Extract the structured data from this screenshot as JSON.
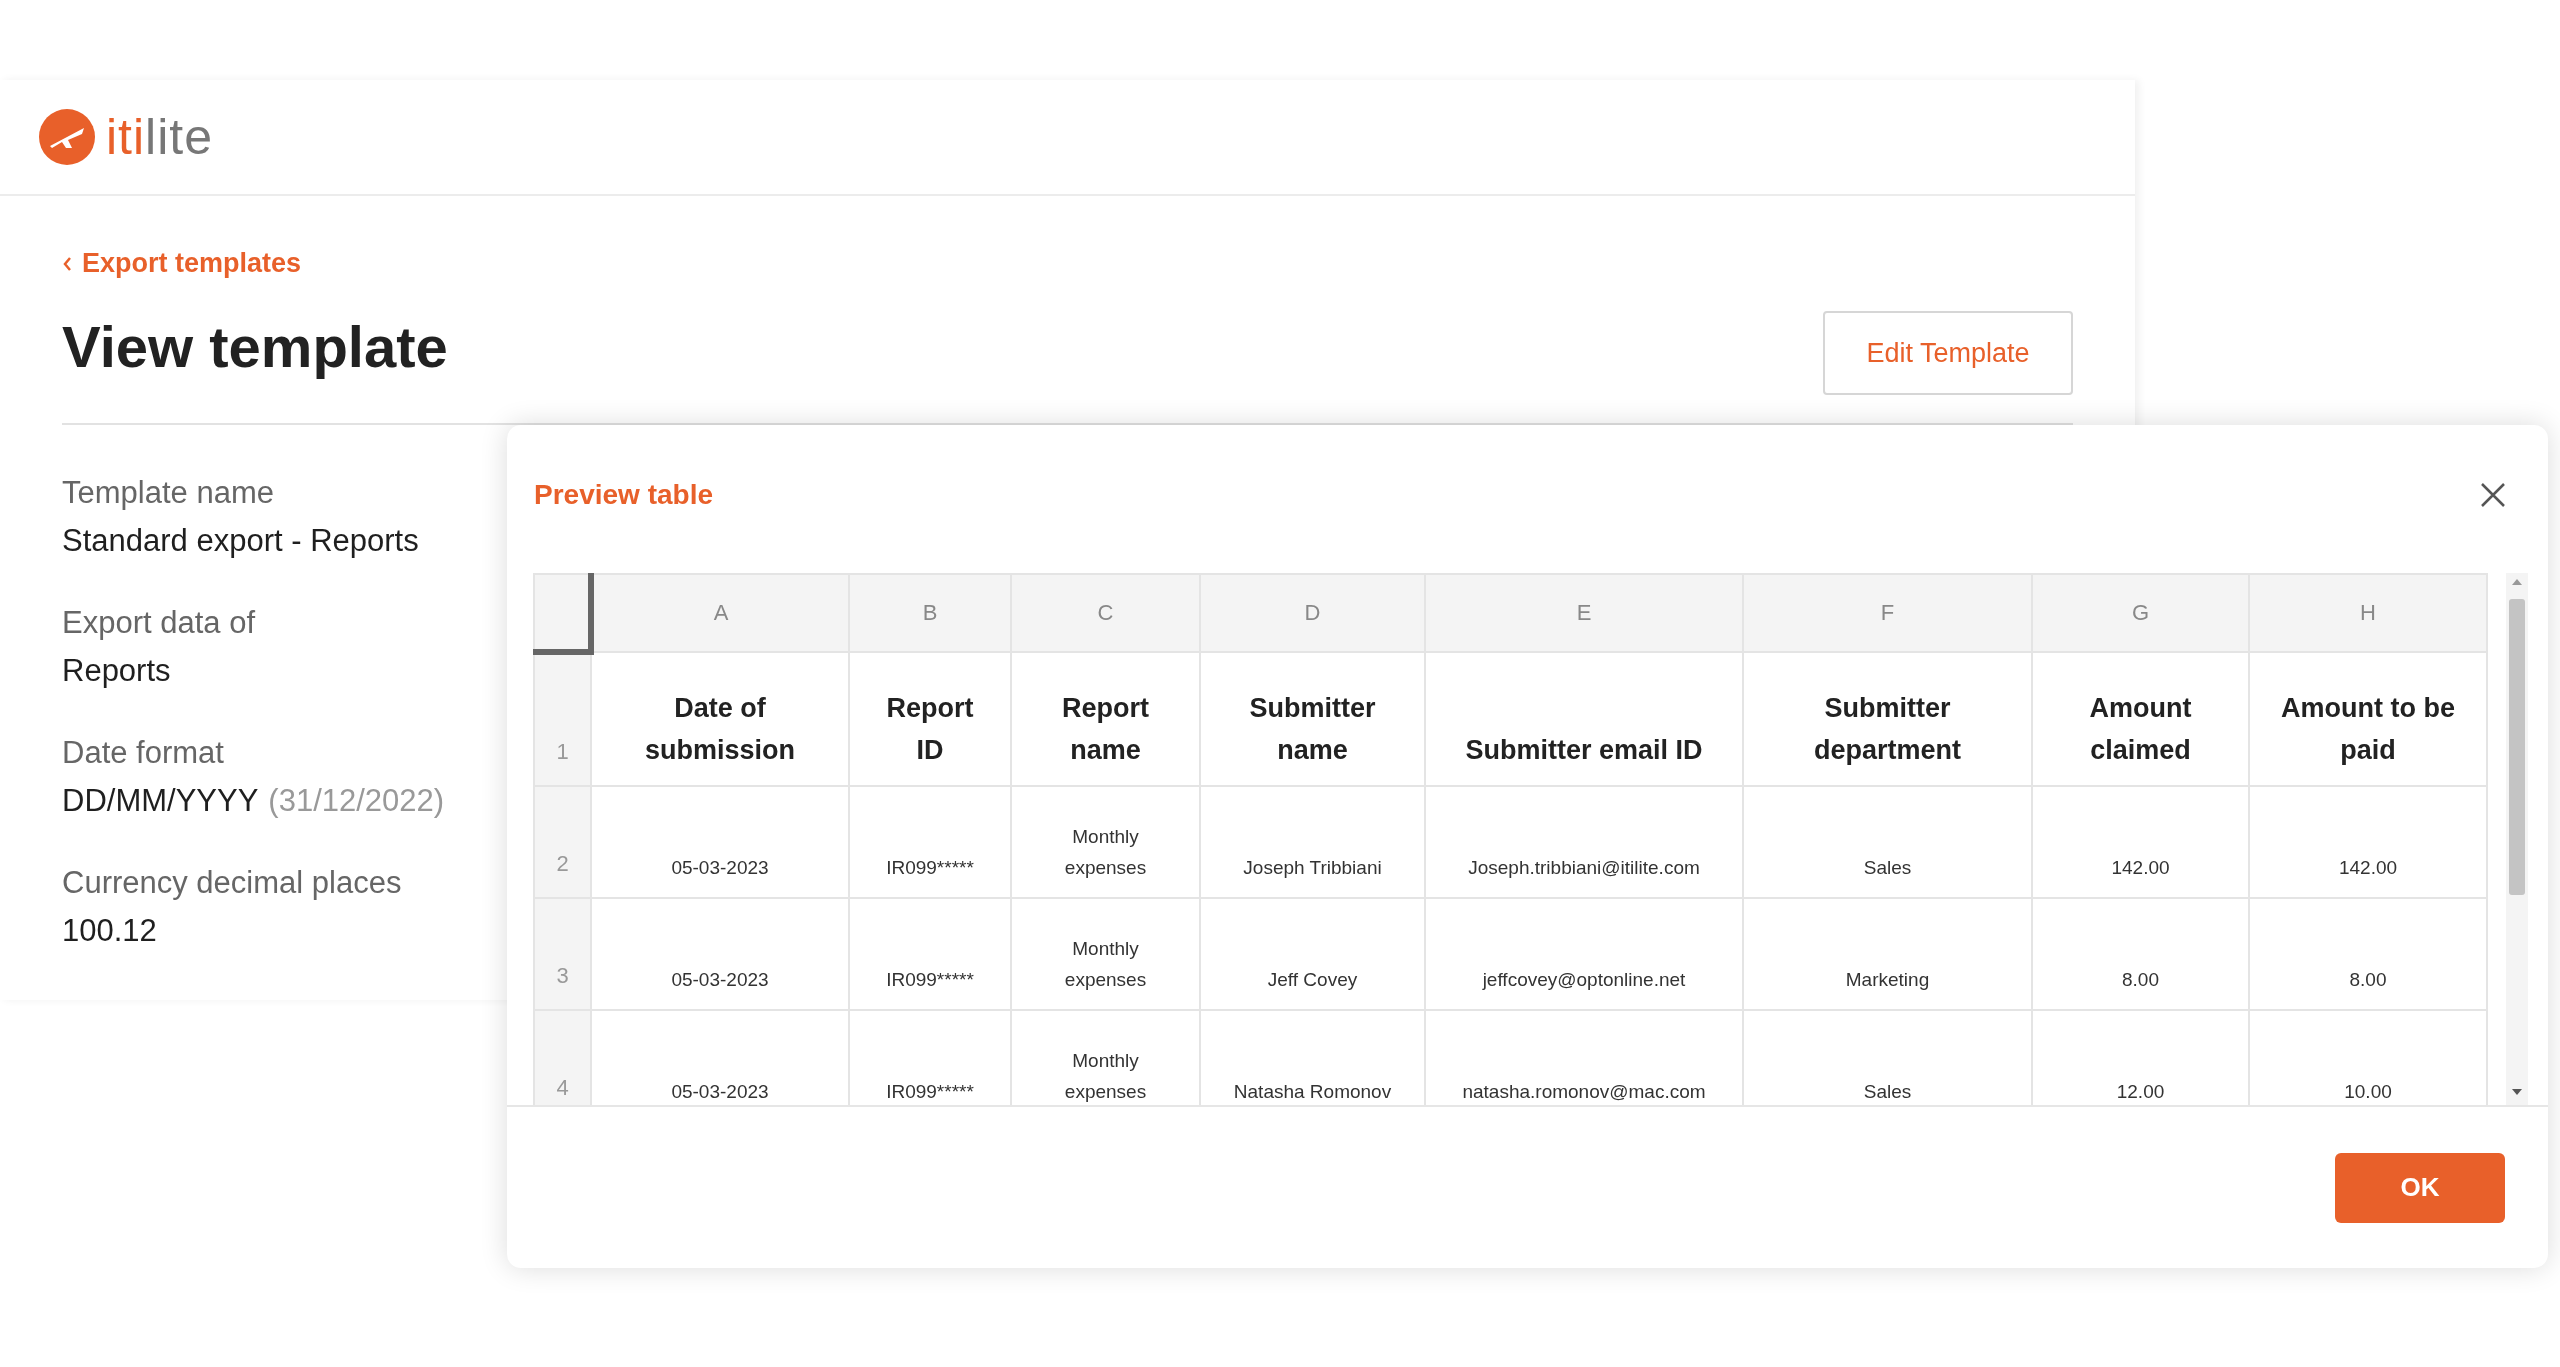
{
  "brand": {
    "accent": "iti",
    "rest": "lite"
  },
  "back_link": {
    "label": "Export templates"
  },
  "title": "View template",
  "edit_button": "Edit Template",
  "details": [
    {
      "label": "Template name",
      "value": "Standard export - Reports"
    },
    {
      "label": "Export data of",
      "value": "Reports"
    },
    {
      "label": "Date format",
      "value": "DD/MM/YYYY",
      "hint": "(31/12/2022)"
    },
    {
      "label": "Currency decimal places",
      "value": "100.12"
    }
  ],
  "modal": {
    "title": "Preview table",
    "table": {
      "column_letters": [
        "A",
        "B",
        "C",
        "D",
        "E",
        "F",
        "G",
        "H"
      ],
      "header": {
        "number": "1",
        "cells": [
          "Date of submission",
          "Report ID",
          "Report name",
          "Submitter name",
          "Submitter email ID",
          "Submitter department",
          "Amount claimed",
          "Amount to be paid"
        ]
      },
      "rows": [
        {
          "number": "2",
          "cells": [
            "05-03-2023",
            "IR099*****",
            "Monthly expenses",
            "Joseph Tribbiani",
            "Joseph.tribbiani@itilite.com",
            "Sales",
            "142.00",
            "142.00"
          ]
        },
        {
          "number": "3",
          "cells": [
            "05-03-2023",
            "IR099*****",
            "Monthly expenses",
            "Jeff Covey",
            "jeffcovey@optonline.net",
            "Marketing",
            "8.00",
            "8.00"
          ]
        },
        {
          "number": "4",
          "cells": [
            "05-03-2023",
            "IR099*****",
            "Monthly expenses",
            "Natasha Romonov",
            "natasha.romonov@mac.com",
            "Sales",
            "12.00",
            "10.00"
          ]
        }
      ]
    },
    "ok_button": "OK"
  }
}
